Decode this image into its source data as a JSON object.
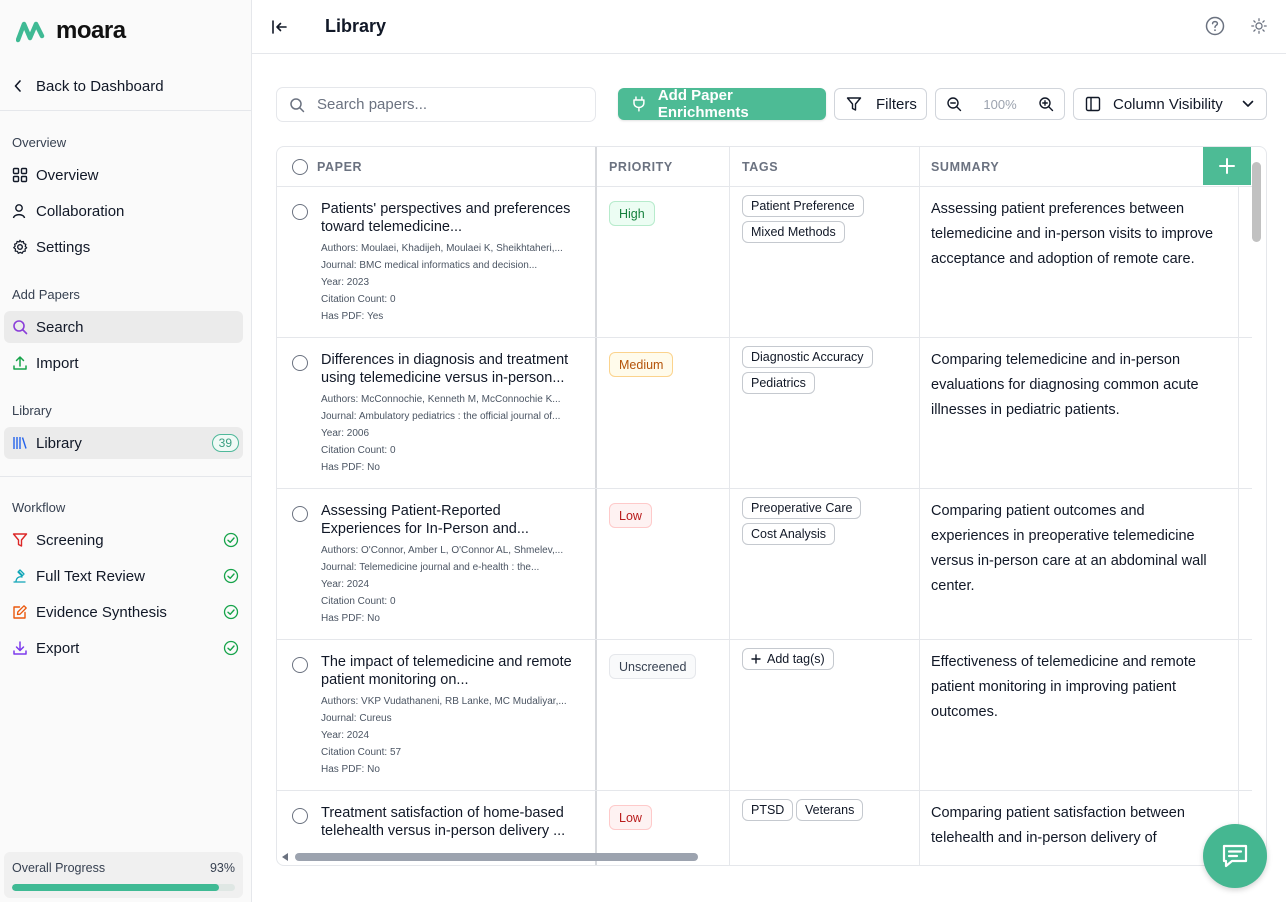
{
  "app": {
    "brand": "moara"
  },
  "sidebar": {
    "back_label": "Back to Dashboard",
    "sections": {
      "overview": "Overview",
      "add_papers": "Add Papers",
      "library": "Library",
      "workflow": "Workflow"
    },
    "items": {
      "overview": "Overview",
      "collaboration": "Collaboration",
      "settings": "Settings",
      "search": "Search",
      "import": "Import",
      "library": "Library",
      "library_count": "39",
      "screening": "Screening",
      "full_text_review": "Full Text Review",
      "evidence_synthesis": "Evidence Synthesis",
      "export": "Export"
    },
    "progress": {
      "label": "Overall Progress",
      "value_text": "93%",
      "value": 0.93
    }
  },
  "header": {
    "title": "Library"
  },
  "toolbar": {
    "search_placeholder": "Search papers...",
    "enrich_label": "Add Paper Enrichments",
    "filters_label": "Filters",
    "zoom_value": "100%",
    "column_visibility_label": "Column Visibility"
  },
  "table": {
    "columns": {
      "paper": "PAPER",
      "priority": "PRIORITY",
      "tags": "TAGS",
      "summary": "SUMMARY"
    },
    "rows": [
      {
        "title": "Patients' perspectives and preferences toward telemedicine...",
        "authors": "Moulaei, Khadijeh, Moulaei K, Sheikhtaheri,...",
        "journal": "BMC medical informatics and decision...",
        "year": "2023",
        "citations": "0",
        "has_pdf": "Yes",
        "priority": "High",
        "tags": [
          "Patient Preference",
          "Mixed Methods"
        ],
        "summary": "Assessing patient preferences between telemedicine and in-person visits to improve acceptance and adoption of remote care."
      },
      {
        "title": "Differences in diagnosis and treatment using telemedicine versus in-person...",
        "authors": "McConnochie, Kenneth M, McConnochie K...",
        "journal": "Ambulatory pediatrics : the official journal of...",
        "year": "2006",
        "citations": "0",
        "has_pdf": "No",
        "priority": "Medium",
        "tags": [
          "Diagnostic Accuracy",
          "Pediatrics"
        ],
        "summary": "Comparing telemedicine and in-person evaluations for diagnosing common acute illnesses in pediatric patients."
      },
      {
        "title": "Assessing Patient-Reported Experiences for In-Person and...",
        "authors": "O'Connor, Amber L, O'Connor AL, Shmelev,...",
        "journal": "Telemedicine journal and e-health : the...",
        "year": "2024",
        "citations": "0",
        "has_pdf": "No",
        "priority": "Low",
        "tags": [
          "Preoperative Care",
          "Cost Analysis"
        ],
        "summary": "Comparing patient outcomes and experiences in preoperative telemedicine versus in-person care at an abdominal wall center."
      },
      {
        "title": "The impact of telemedicine and remote patient monitoring on...",
        "authors": "VKP Vudathaneni, RB Lanke, MC Mudaliyar,...",
        "journal": "Cureus",
        "year": "2024",
        "citations": "57",
        "has_pdf": "No",
        "priority": "Unscreened",
        "add_tag_label": "Add tag(s)",
        "summary": "Effectiveness of telemedicine and remote patient monitoring in improving patient outcomes."
      },
      {
        "title": "Treatment satisfaction of home-based telehealth versus in-person delivery ...",
        "priority": "Low",
        "tags": [
          "PTSD",
          "Veterans"
        ],
        "summary": "Comparing patient satisfaction between telehealth and in-person delivery of"
      }
    ],
    "meta_labels": {
      "authors": "Authors:",
      "journal": "Journal:",
      "year": "Year:",
      "citations": "Citation Count:",
      "has_pdf": "Has PDF:"
    }
  },
  "colors": {
    "accent": "#4dbb95",
    "high": "#15803d",
    "medium": "#b45309",
    "low": "#b91c1c"
  }
}
